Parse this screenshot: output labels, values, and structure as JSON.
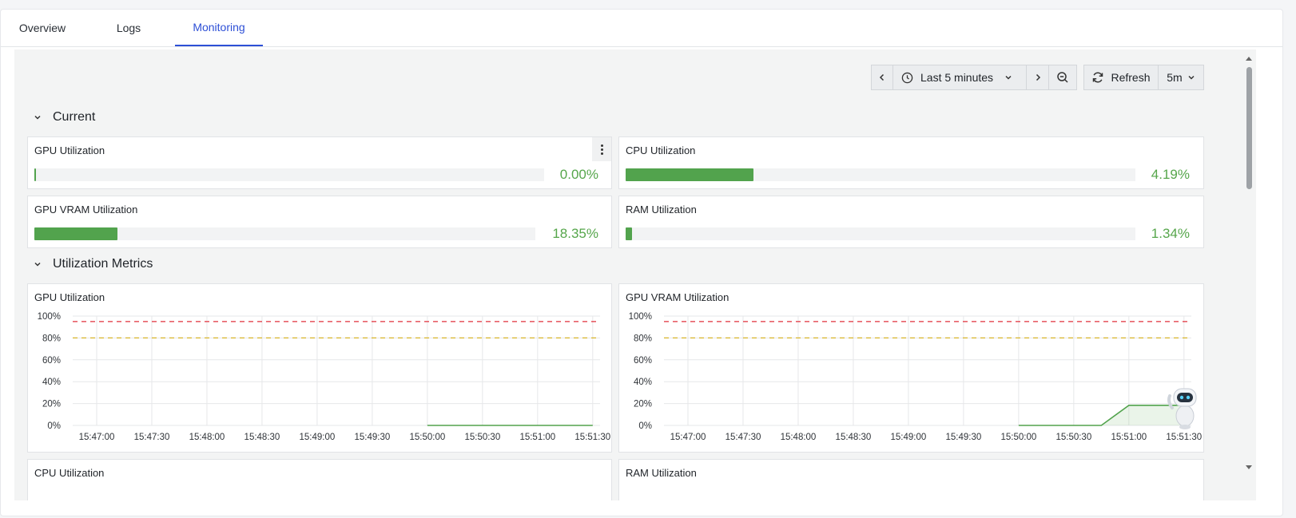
{
  "tabs": [
    {
      "label": "Overview"
    },
    {
      "label": "Logs"
    },
    {
      "label": "Monitoring"
    }
  ],
  "toolbar": {
    "time_range": "Last 5 minutes",
    "refresh_label": "Refresh",
    "interval": "5m"
  },
  "sections": {
    "current": "Current",
    "metrics": "Utilization Metrics"
  },
  "current": [
    {
      "title": "GPU Utilization",
      "value": "0.00%",
      "fraction": 0.0
    },
    {
      "title": "CPU Utilization",
      "value": "4.19%",
      "fraction": 0.0419
    },
    {
      "title": "GPU VRAM Utilization",
      "value": "18.35%",
      "fraction": 0.1835
    },
    {
      "title": "RAM Utilization",
      "value": "1.34%",
      "fraction": 0.0134
    }
  ],
  "colors": {
    "accent": "#2d4fd6",
    "bar": "#52a34d",
    "value_text": "#56a64b",
    "threshold_red": "#e0303b",
    "threshold_yellow": "#d9b52a"
  },
  "chart_data": [
    {
      "type": "line",
      "title": "GPU Utilization",
      "x": [
        "15:47:00",
        "15:47:30",
        "15:48:00",
        "15:48:30",
        "15:49:00",
        "15:49:30",
        "15:50:00",
        "15:50:30",
        "15:51:00",
        "15:51:30"
      ],
      "yticks": [
        "0%",
        "20%",
        "40%",
        "60%",
        "80%",
        "100%"
      ],
      "ylim": [
        0,
        100
      ],
      "thresholds": [
        95,
        80
      ],
      "series": [
        {
          "points": [
            [
              "15:50:00",
              0
            ],
            [
              "15:50:30",
              0
            ],
            [
              "15:51:00",
              0
            ],
            [
              "15:51:30",
              0
            ]
          ]
        }
      ]
    },
    {
      "type": "area",
      "title": "GPU VRAM Utilization",
      "x": [
        "15:47:00",
        "15:47:30",
        "15:48:00",
        "15:48:30",
        "15:49:00",
        "15:49:30",
        "15:50:00",
        "15:50:30",
        "15:51:00",
        "15:51:30"
      ],
      "yticks": [
        "0%",
        "20%",
        "40%",
        "60%",
        "80%",
        "100%"
      ],
      "ylim": [
        0,
        100
      ],
      "thresholds": [
        95,
        80
      ],
      "series": [
        {
          "points": [
            [
              "15:50:00",
              0
            ],
            [
              "15:50:30",
              0
            ],
            [
              "15:50:45",
              0
            ],
            [
              "15:51:00",
              18.35
            ],
            [
              "15:51:30",
              18.35
            ]
          ]
        }
      ]
    }
  ],
  "lower_cards": [
    {
      "title": "CPU Utilization"
    },
    {
      "title": "RAM Utilization"
    }
  ]
}
